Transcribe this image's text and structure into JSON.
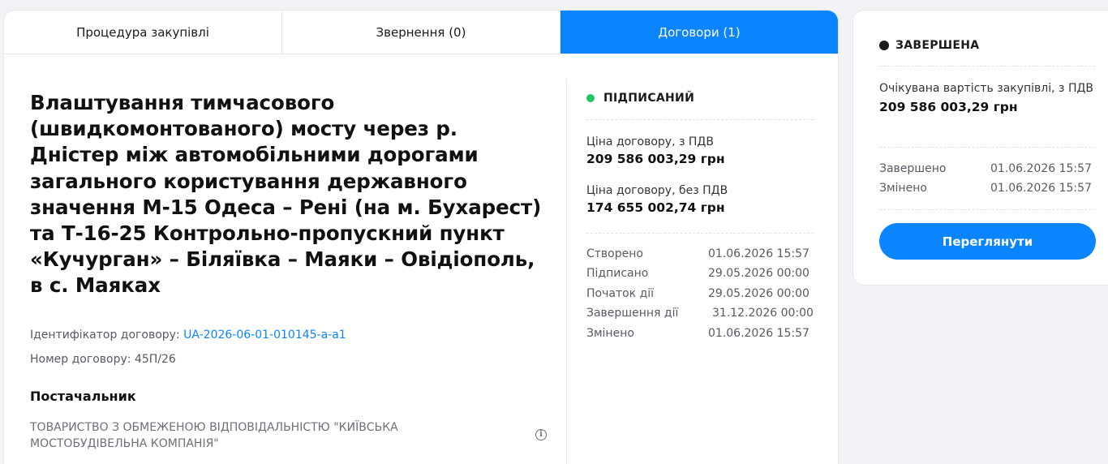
{
  "tabs": [
    {
      "label": "Процедура закупівлі",
      "active": false
    },
    {
      "label": "Звернення (0)",
      "active": false
    },
    {
      "label": "Договори (1)",
      "active": true
    }
  ],
  "contract": {
    "title": "Влаштування тимчасового (швидкомонтованого) мосту через р. Дністер між автомобільними дорогами загального користування державного значення М-15 Одеса – Рені (на м. Бухарест) та Т-16-25 Контрольно-пропускний пункт «Кучурган» – Біляївка – Маяки – Овідіополь, в с. Маяках",
    "id_label": "Ідентифікатор договору:",
    "id_value": "UA-2026-06-01-010145-a-a1",
    "number_label": "Номер договору:",
    "number_value": "45П/26",
    "supplier_heading": "Постачальник",
    "supplier_name": "ТОВАРИСТВО З ОБМЕЖЕНОЮ ВІДПОВІДАЛЬНІСТЮ \"КИЇВСЬКА МОСТОБУДІВЕЛЬНА КОМПАНІЯ\""
  },
  "contract_status": {
    "label": "ПІДПИСАНИЙ",
    "color": "#22c55e",
    "price_vat_label": "Ціна договору, з ПДВ",
    "price_vat_value": "209 586 003,29 грн",
    "price_novat_label": "Ціна договору, без ПДВ",
    "price_novat_value": "174 655 002,74 грн",
    "dates": [
      {
        "label": "Створено",
        "value": "01.06.2026 15:57"
      },
      {
        "label": "Підписано",
        "value": "29.05.2026 00:00"
      },
      {
        "label": "Початок дії",
        "value": "29.05.2026 00:00"
      },
      {
        "label": "Завершення дії",
        "value": "31.12.2026 00:00"
      },
      {
        "label": "Змінено",
        "value": "01.06.2026 15:57"
      }
    ]
  },
  "tender": {
    "status_label": "ЗАВЕРШЕНА",
    "status_color": "#1a1a1a",
    "expected_label": "Очікувана вартість закупівлі, з ПДВ",
    "expected_value": "209 586 003,29 грн",
    "dates": [
      {
        "label": "Завершено",
        "value": "01.06.2026 15:57"
      },
      {
        "label": "Змінено",
        "value": "01.06.2026 15:57"
      }
    ],
    "view_button": "Переглянути"
  },
  "colors": {
    "accent": "#0a84ff",
    "signed": "#22c55e"
  },
  "icons": {
    "supplier_info": "info-icon"
  }
}
